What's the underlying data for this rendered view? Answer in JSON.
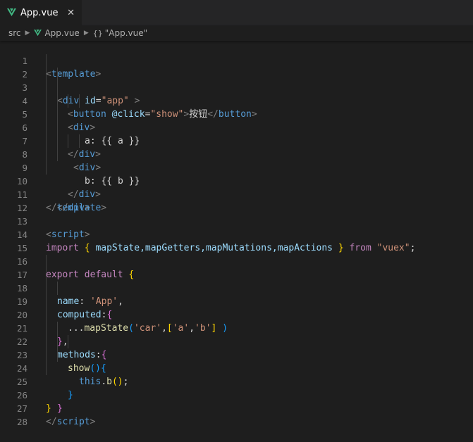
{
  "tab": {
    "label": "App.vue",
    "close_glyph": "✕"
  },
  "breadcrumbs": {
    "folder": "src",
    "file": "App.vue",
    "symbol": "\"App.vue\""
  },
  "code": {
    "l1": [
      "<",
      "template",
      ">"
    ],
    "l2": [
      "<",
      "div",
      " ",
      "id",
      "=",
      "\"app\"",
      " >"
    ],
    "l3": [
      "<",
      "button",
      " ",
      "@click",
      "=",
      "\"show\"",
      ">",
      "按钮",
      "</",
      "button",
      ">"
    ],
    "l4": [
      "<",
      "div",
      ">"
    ],
    "l5": [
      "a: {{ a }}"
    ],
    "l6": [
      "</",
      "div",
      ">"
    ],
    "l7": [
      "<",
      "div",
      ">"
    ],
    "l8": [
      "b: {{ b }}"
    ],
    "l9": [
      "</",
      "div",
      ">"
    ],
    "l10": [
      "</",
      "div",
      ">"
    ],
    "l11": [
      "</",
      "template",
      ">"
    ],
    "l13": [
      "<",
      "script",
      ">"
    ],
    "l14": [
      "import",
      " ",
      "{",
      " mapState,mapGetters,mapMutations,mapActions ",
      "}",
      " ",
      "from",
      " ",
      "\"vuex\"",
      ";"
    ],
    "l16": [
      "export",
      " ",
      "default",
      " ",
      "{"
    ],
    "l17": [
      "name",
      ": ",
      "'App'",
      ","
    ],
    "l18": [
      "computed",
      ":",
      "{"
    ],
    "l19": [
      "...",
      "mapState",
      "(",
      "'car'",
      ",",
      "[",
      "'a'",
      ",",
      "'b'",
      "]",
      " ",
      ")"
    ],
    "l20": [
      "}",
      ","
    ],
    "l21": [
      "methods",
      ":",
      "{"
    ],
    "l22": [
      "show",
      "(",
      ")",
      "{"
    ],
    "l23": [
      "this",
      ".",
      "b",
      "(",
      ")",
      ";"
    ],
    "l24": [
      "}"
    ],
    "l25": [
      "}"
    ],
    "l26": [
      "}"
    ],
    "l27": [
      "</",
      "script",
      ">"
    ]
  },
  "line_numbers": [
    "1",
    "2",
    "3",
    "4",
    "5",
    "6",
    "7",
    "8",
    "9",
    "10",
    "11",
    "12",
    "13",
    "14",
    "15",
    "16",
    "17",
    "18",
    "19",
    "20",
    "21",
    "22",
    "23",
    "24",
    "25",
    "26",
    "27",
    "28"
  ],
  "colors": {
    "background": "#1e1e1e",
    "tag": "#569cd6",
    "attribute": "#9cdcfe",
    "string": "#ce9178",
    "keyword": "#c586c0",
    "function": "#dcdcaa",
    "bracket_gold": "#ffd700",
    "bracket_orchid": "#da70d6",
    "bracket_blue": "#179fff",
    "vue_green": "#41b883"
  }
}
